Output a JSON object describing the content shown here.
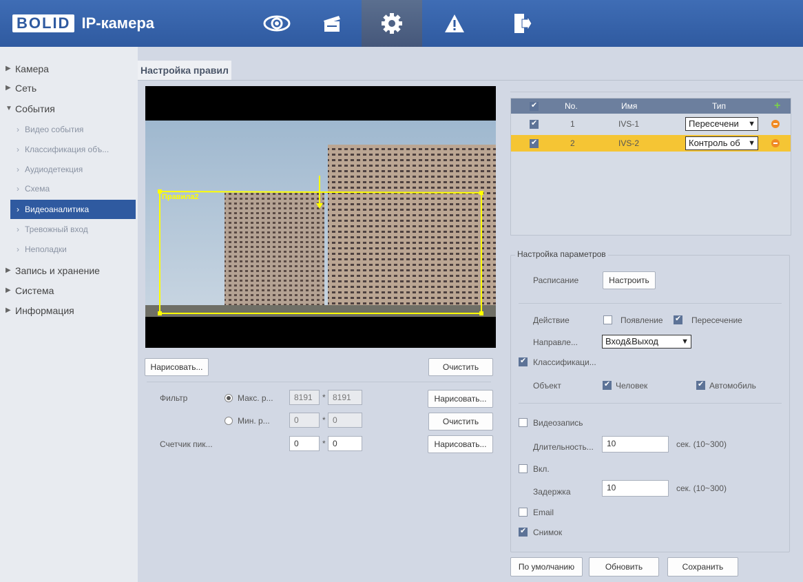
{
  "header": {
    "logo": "BOLID",
    "title": "IP-камера",
    "icons": [
      "eye-icon",
      "clapperboard-icon",
      "gear-icon",
      "warning-icon",
      "exit-icon"
    ]
  },
  "sidebar": {
    "items": [
      {
        "label": "Камера"
      },
      {
        "label": "Сеть"
      },
      {
        "label": "События"
      },
      {
        "label": "Видео события"
      },
      {
        "label": "Классификация объ..."
      },
      {
        "label": "Аудиодетекция"
      },
      {
        "label": "Схема"
      },
      {
        "label": "Видеоаналитика"
      },
      {
        "label": "Тревожный вход"
      },
      {
        "label": "Неполадки"
      },
      {
        "label": "Запись и хранение"
      },
      {
        "label": "Система"
      },
      {
        "label": "Информация"
      }
    ]
  },
  "tab": "Настройка правил",
  "video": {
    "rule_label": "Правила2"
  },
  "left_controls": {
    "draw_label": "Нарисовать...",
    "clear_label": "Очистить",
    "filter_label": "Фильтр",
    "max_label": "Макс. р...",
    "max_w": "8191",
    "max_h": "8191",
    "min_label": "Мин. р...",
    "min_w": "0",
    "min_h": "0",
    "draw2_label": "Нарисовать...",
    "clear2_label": "Очистить",
    "pixel_label": "Счетчик пик...",
    "pix_w": "0",
    "pix_h": "0",
    "draw3_label": "Нарисовать...",
    "times": "*"
  },
  "rules_table": {
    "headers": {
      "no": "No.",
      "name": "Имя",
      "type": "Тип"
    },
    "rows": [
      {
        "no": "1",
        "name": "IVS-1",
        "type": "Пересечени"
      },
      {
        "no": "2",
        "name": "IVS-2",
        "type": "Контроль об"
      }
    ]
  },
  "params": {
    "legend": "Настройка параметров",
    "schedule_label": "Расписание",
    "schedule_button": "Настроить",
    "action_label": "Действие",
    "appear_label": "Появление",
    "cross_label": "Пересечение",
    "direction_label": "Направле...",
    "direction_value": "Вход&Выход",
    "classification_label": "Классификаци...",
    "object_label": "Объект",
    "person_label": "Человек",
    "car_label": "Автомобиль",
    "record_label": "Видеозапись",
    "duration_label": "Длительность...",
    "duration_value": "10",
    "duration_unit": "сек. (10~300)",
    "on_label": "Вкл.",
    "delay_label": "Задержка",
    "delay_value": "10",
    "delay_unit": "сек. (10~300)",
    "email_label": "Email",
    "snapshot_label": "Снимок"
  },
  "footer": {
    "default_label": "По умолчанию",
    "refresh_label": "Обновить",
    "save_label": "Сохранить"
  },
  "colors": {
    "header": "#2f5aa0",
    "accent": "#f5c534",
    "rule_line": "#ffff00"
  }
}
